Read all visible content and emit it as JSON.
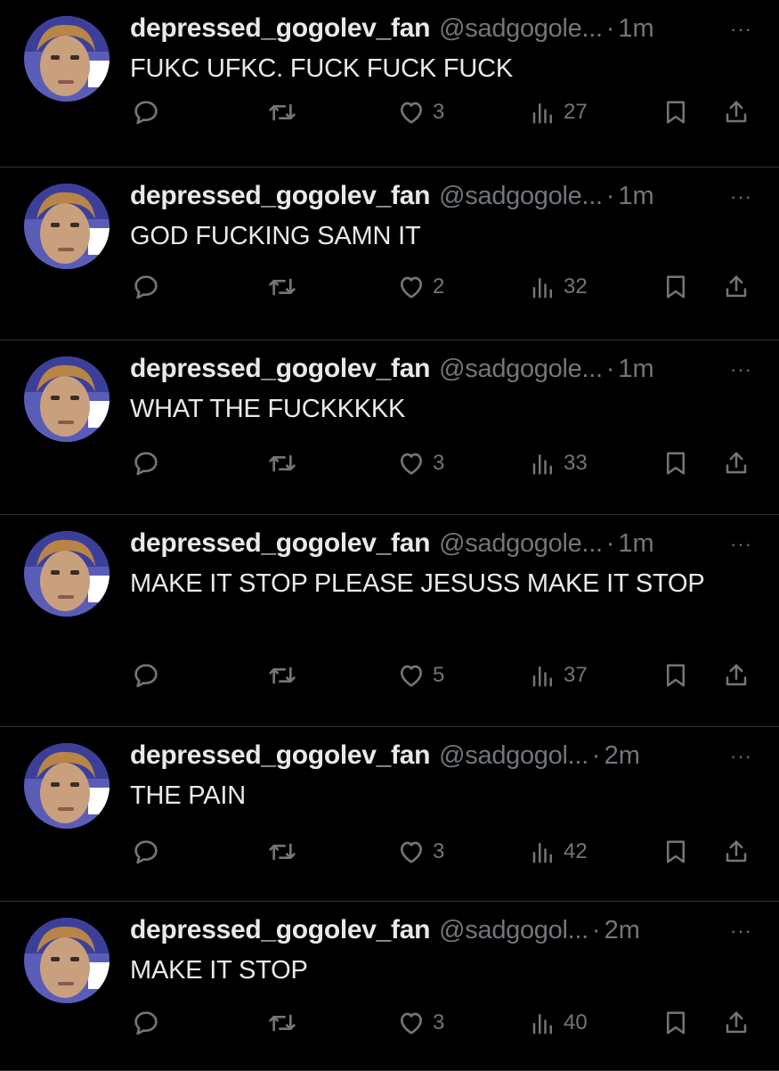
{
  "colors": {
    "background": "#000000",
    "text": "#e7e9ea",
    "muted": "#71767b",
    "divider": "#2f3336"
  },
  "icons": {
    "reply": "reply-icon",
    "retweet": "retweet-icon",
    "like": "heart-icon",
    "views": "views-icon",
    "bookmark": "bookmark-icon",
    "share": "share-icon",
    "more": "more-icon"
  },
  "tweets": [
    {
      "display_name": "depressed_gogolev_fan",
      "handle": "@sadgogole...",
      "separator": "·",
      "time": "1m",
      "more": "···",
      "text": "FUKC UFKC. FUCK FUCK FUCK",
      "likes": "3",
      "views": "27"
    },
    {
      "display_name": "depressed_gogolev_fan",
      "handle": "@sadgogole...",
      "separator": "·",
      "time": "1m",
      "more": "···",
      "text": "GOD FUCKING SAMN IT",
      "likes": "2",
      "views": "32"
    },
    {
      "display_name": "depressed_gogolev_fan",
      "handle": "@sadgogole...",
      "separator": "·",
      "time": "1m",
      "more": "···",
      "text": "WHAT THE FUCKKKKK",
      "likes": "3",
      "views": "33"
    },
    {
      "display_name": "depressed_gogolev_fan",
      "handle": "@sadgogole...",
      "separator": "·",
      "time": "1m",
      "more": "···",
      "text": "MAKE IT STOP PLEASE JESUSS MAKE IT STOP",
      "likes": "5",
      "views": "37"
    },
    {
      "display_name": "depressed_gogolev_fan",
      "handle": "@sadgogol...",
      "separator": "·",
      "time": "2m",
      "more": "···",
      "text": "THE PAIN",
      "likes": "3",
      "views": "42"
    },
    {
      "display_name": "depressed_gogolev_fan",
      "handle": "@sadgogol...",
      "separator": "·",
      "time": "2m",
      "more": "···",
      "text": "MAKE IT STOP",
      "likes": "3",
      "views": "40"
    }
  ]
}
